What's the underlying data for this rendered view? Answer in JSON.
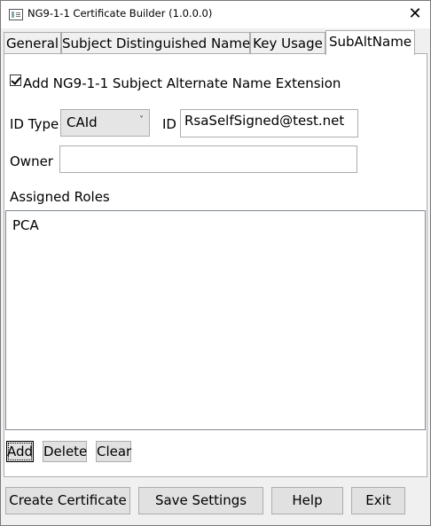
{
  "window": {
    "title": "NG9-1-1 Certificate Builder (1.0.0.0)",
    "close_symbol": "✕"
  },
  "tabs": [
    {
      "label": "General"
    },
    {
      "label": "Subject Distinguished Name"
    },
    {
      "label": "Key Usage"
    },
    {
      "label": "SubAltName",
      "active": true
    }
  ],
  "subaltname": {
    "extension_checkbox": {
      "label": "Add NG9-1-1 Subject Alternate Name Extension",
      "checked": true
    },
    "id_type": {
      "label": "ID Type",
      "value": "CAId"
    },
    "id": {
      "label": "ID",
      "value": "RsaSelfSigned@test.net"
    },
    "owner": {
      "label": "Owner",
      "value": ""
    },
    "assigned_roles": {
      "label": "Assigned Roles",
      "items": [
        "PCA"
      ]
    },
    "buttons": {
      "add": "Add",
      "delete": "Delete",
      "clear": "Clear"
    }
  },
  "footer": {
    "create": "Create Certificate",
    "save": "Save Settings",
    "help": "Help",
    "exit": "Exit"
  },
  "icons": {
    "dropdown": "chevron-down-icon",
    "app": "window-app-icon"
  }
}
